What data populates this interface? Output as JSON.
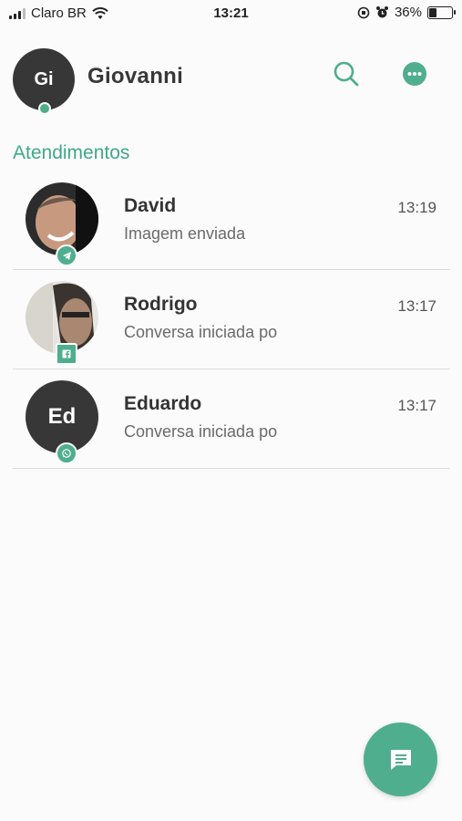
{
  "status_bar": {
    "carrier": "Claro BR",
    "time": "13:21",
    "battery": "36%",
    "battery_level": 0.36
  },
  "header": {
    "avatar_initials": "Gi",
    "user_name": "Giovanni",
    "search_icon": "search-icon",
    "more_icon": "more-options-icon"
  },
  "section": {
    "title": "Atendimentos"
  },
  "conversations": [
    {
      "name": "David",
      "time": "13:19",
      "message": "Imagem enviada",
      "channel": "telegram"
    },
    {
      "name": "Rodrigo",
      "time": "13:17",
      "message": "Conversa iniciada po",
      "channel": "facebook"
    },
    {
      "name": "Eduardo",
      "initials": "Ed",
      "time": "13:17",
      "message": "Conversa iniciada po",
      "channel": "whatsapp"
    }
  ],
  "fab": {
    "icon": "new-conversation-icon"
  },
  "colors": {
    "accent": "#4fae8e",
    "avatar_bg": "#373737",
    "section_title": "#3ea985"
  }
}
